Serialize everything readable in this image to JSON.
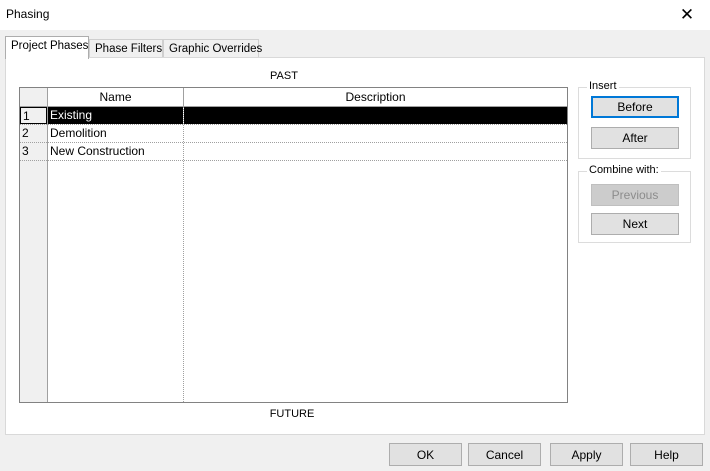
{
  "window": {
    "title": "Phasing",
    "close_glyph": "✕"
  },
  "tabs": [
    {
      "label": "Project Phases",
      "active": true
    },
    {
      "label": "Phase Filters",
      "active": false
    },
    {
      "label": "Graphic Overrides",
      "active": false
    }
  ],
  "grid": {
    "top_label": "PAST",
    "bottom_label": "FUTURE",
    "columns": [
      "Name",
      "Description"
    ],
    "rows": [
      {
        "num": "1",
        "name": "Existing",
        "description": "",
        "selected": true
      },
      {
        "num": "2",
        "name": "Demolition",
        "description": "",
        "selected": false
      },
      {
        "num": "3",
        "name": "New Construction",
        "description": "",
        "selected": false
      }
    ]
  },
  "insert_group": {
    "title": "Insert",
    "before_label": "Before",
    "after_label": "After"
  },
  "combine_group": {
    "title": "Combine with:",
    "previous_label": "Previous",
    "next_label": "Next"
  },
  "footer": {
    "ok_label": "OK",
    "cancel_label": "Cancel",
    "apply_label": "Apply",
    "help_label": "Help"
  },
  "colors": {
    "selection_bg": "#000000",
    "default_button_border": "#0078d7",
    "dialog_bg": "#f0f0f0"
  }
}
